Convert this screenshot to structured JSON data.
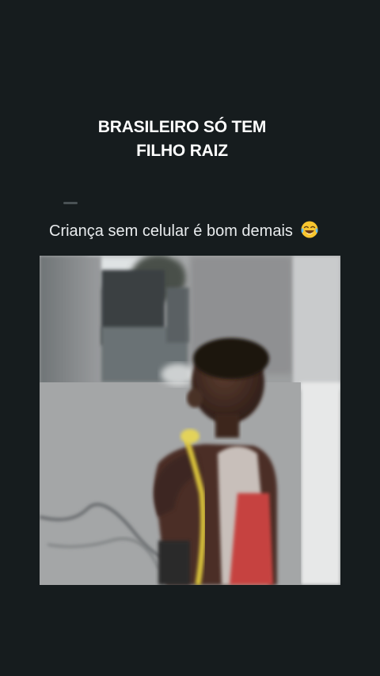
{
  "headline": {
    "line1": "BRASILEIRO SÓ TEM",
    "line2": "FILHO RAIZ"
  },
  "post": {
    "caption": "Criança sem celular é bom demais",
    "caption_emoji": "tears-of-joy-emoji"
  },
  "video": {
    "content": "child-in-red-tank-top-with-hose-video-frame"
  },
  "colors": {
    "background": "#161c1e",
    "headline_text": "#ffffff",
    "caption_text": "#e9ecee"
  }
}
